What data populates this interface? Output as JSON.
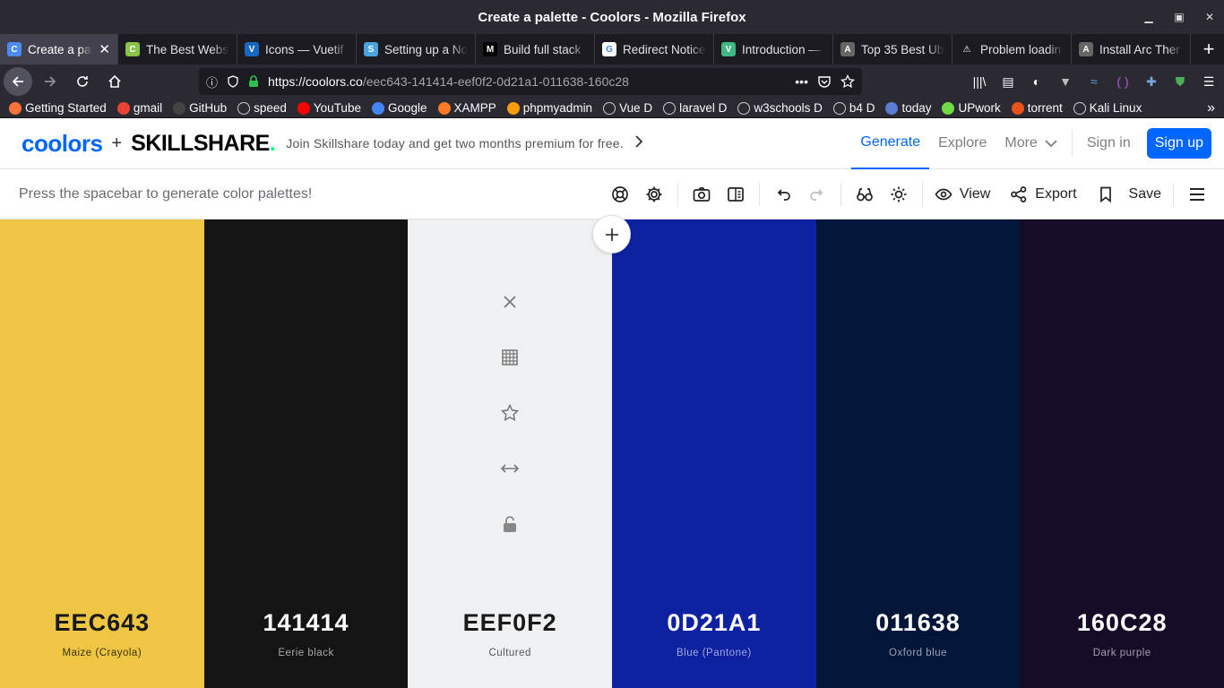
{
  "window": {
    "title": "Create a palette - Coolors - Mozilla Firefox"
  },
  "tabs": [
    {
      "label": "Create a pal",
      "fav_bg": "#4c8bf5",
      "fav_text": "C",
      "active": true
    },
    {
      "label": "The Best Webs",
      "fav_bg": "#8bc34a",
      "fav_text": "C"
    },
    {
      "label": "Icons — Vuetif",
      "fav_bg": "#1867c0",
      "fav_text": "V"
    },
    {
      "label": "Setting up a No",
      "fav_bg": "#4aa3df",
      "fav_text": "S"
    },
    {
      "label": "Build full stack",
      "fav_bg": "#000000",
      "fav_text": "M"
    },
    {
      "label": "Redirect Notice",
      "fav_bg": "#ffffff",
      "fav_text": "G"
    },
    {
      "label": "Introduction —",
      "fav_bg": "#41b883",
      "fav_text": "V"
    },
    {
      "label": "Top 35 Best Ub",
      "fav_bg": "#666666",
      "fav_text": "A"
    },
    {
      "label": "Problem loadin",
      "fav_bg": "#1c1b22",
      "fav_text": "⚠"
    },
    {
      "label": "Install Arc Ther",
      "fav_bg": "#666666",
      "fav_text": "A"
    }
  ],
  "navbar": {
    "url_host": "https://coolors.co",
    "url_rest": "/eec643-141414-eef0f2-0d21a1-011638-160c28"
  },
  "bookmarks": [
    {
      "label": "Getting Started",
      "color": "#ff7139"
    },
    {
      "label": "gmail",
      "color": "#ea4335"
    },
    {
      "label": "GitHub",
      "color": "#444"
    },
    {
      "label": "speed",
      "color": ""
    },
    {
      "label": "YouTube",
      "color": "#ff0000"
    },
    {
      "label": "Google",
      "color": "#4285f4"
    },
    {
      "label": "XAMPP",
      "color": "#fb7a24"
    },
    {
      "label": "phpmyadmin",
      "color": "#f89c0e"
    },
    {
      "label": "Vue D",
      "color": ""
    },
    {
      "label": "laravel D",
      "color": ""
    },
    {
      "label": "w3schools D",
      "color": ""
    },
    {
      "label": "b4 D",
      "color": ""
    },
    {
      "label": "today",
      "color": "#5b7bd5"
    },
    {
      "label": "UPwork",
      "color": "#6fda44"
    },
    {
      "label": "torrent",
      "color": "#e8531c"
    },
    {
      "label": "Kali Linux",
      "color": ""
    }
  ],
  "header": {
    "logo_coolors": "coolors",
    "logo_plus": "+",
    "logo_skill": "SKILLSHARE",
    "logo_dot": ".",
    "promo": "Join Skillshare today and get two months premium for free.",
    "nav_generate": "Generate",
    "nav_explore": "Explore",
    "nav_more": "More",
    "sign_in": "Sign in",
    "sign_up": "Sign up"
  },
  "toolbar": {
    "hint": "Press the spacebar to generate color palettes!",
    "view_label": "View",
    "export_label": "Export",
    "save_label": "Save"
  },
  "palette": [
    {
      "hex": "EEC643",
      "name": "Maize (Crayola)",
      "bg": "#eec643",
      "fg": "#1a1a1a",
      "sub": "#3d3314"
    },
    {
      "hex": "141414",
      "name": "Eerie black",
      "bg": "#141414",
      "fg": "#ffffff",
      "sub": "#a9a9a9"
    },
    {
      "hex": "EEF0F2",
      "name": "Cultured",
      "bg": "#eef0f2",
      "fg": "#1a1a1a",
      "sub": "#555555"
    },
    {
      "hex": "0D21A1",
      "name": "Blue (Pantone)",
      "bg": "#0d21a1",
      "fg": "#ffffff",
      "sub": "#9fa8e0"
    },
    {
      "hex": "011638",
      "name": "Oxford blue",
      "bg": "#011638",
      "fg": "#ffffff",
      "sub": "#9aa3b5"
    },
    {
      "hex": "160C28",
      "name": "Dark purple",
      "bg": "#160c28",
      "fg": "#ffffff",
      "sub": "#a39fad"
    }
  ]
}
